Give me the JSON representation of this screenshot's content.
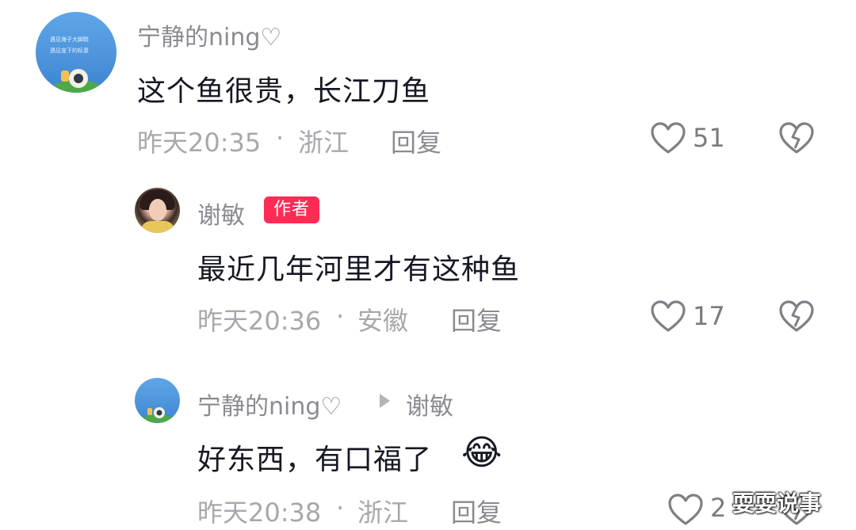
{
  "comments": [
    {
      "username": "宁静的ning♡",
      "content": "这个鱼很贵，长江刀鱼",
      "time": "昨天20:35",
      "separator": "·",
      "location": "浙江",
      "reply_label": "回复",
      "likes": "51"
    },
    {
      "username": "谢敏",
      "author_badge": "作者",
      "content": "最近几年河里才有这种鱼",
      "time": "昨天20:36",
      "separator": "·",
      "location": "安徽",
      "reply_label": "回复",
      "likes": "17"
    },
    {
      "username": "宁静的ning♡",
      "reply_to": "谢敏",
      "content": "好东西，有口福了",
      "emoji": "😂",
      "time": "昨天20:38",
      "separator": "·",
      "location": "浙江",
      "reply_label": "回复",
      "likes": "2"
    }
  ],
  "avatar_texts": {
    "line1": "遇见海子大脚鞋",
    "line2": "遇见宠下的标意"
  },
  "watermark": "耍耍说事",
  "colors": {
    "author_badge": "#fe2c55",
    "username": "#8a8b91",
    "meta": "#a7a8ad",
    "icon": "#8a8b91"
  },
  "icons": [
    "heart-icon",
    "dislike-broken-heart-icon",
    "reply-arrow-icon",
    "laughing-emoji-icon"
  ]
}
